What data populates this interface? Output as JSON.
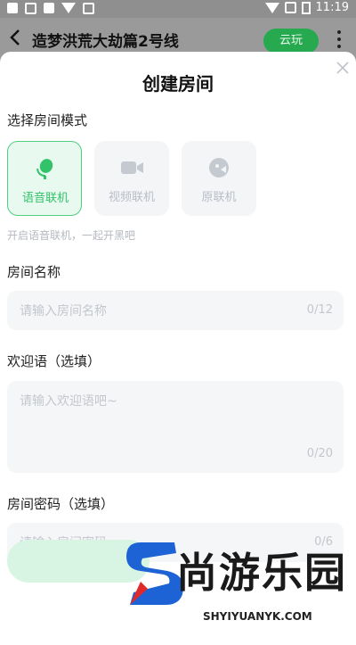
{
  "status": {
    "time": "11:19"
  },
  "appbar": {
    "title": "造梦洪荒大劫篇2号线",
    "cloud_button": "云玩"
  },
  "dialog": {
    "title": "创建房间",
    "mode_label": "选择房间模式",
    "modes": [
      {
        "label": "语音联机",
        "icon": "microphone-icon",
        "selected": true
      },
      {
        "label": "视频联机",
        "icon": "video-camera-icon",
        "selected": false
      },
      {
        "label": "原联机",
        "icon": "gamepad-icon",
        "selected": false
      }
    ],
    "mode_hint": "开启语音联机，一起开黑吧",
    "room_name": {
      "label": "房间名称",
      "placeholder": "请输入房间名称",
      "count": "0/12"
    },
    "welcome": {
      "label": "欢迎语（选填）",
      "placeholder": "请输入欢迎语吧~",
      "count": "0/20"
    },
    "password": {
      "label": "房间密码（选填）",
      "placeholder": "请输入房间密码",
      "count": "0/6"
    }
  },
  "watermark": {
    "text": "尚游乐园",
    "url": "SHYIYUANYK.COM"
  },
  "colors": {
    "accent": "#32c26a",
    "cloud_button": "#27a94f"
  }
}
